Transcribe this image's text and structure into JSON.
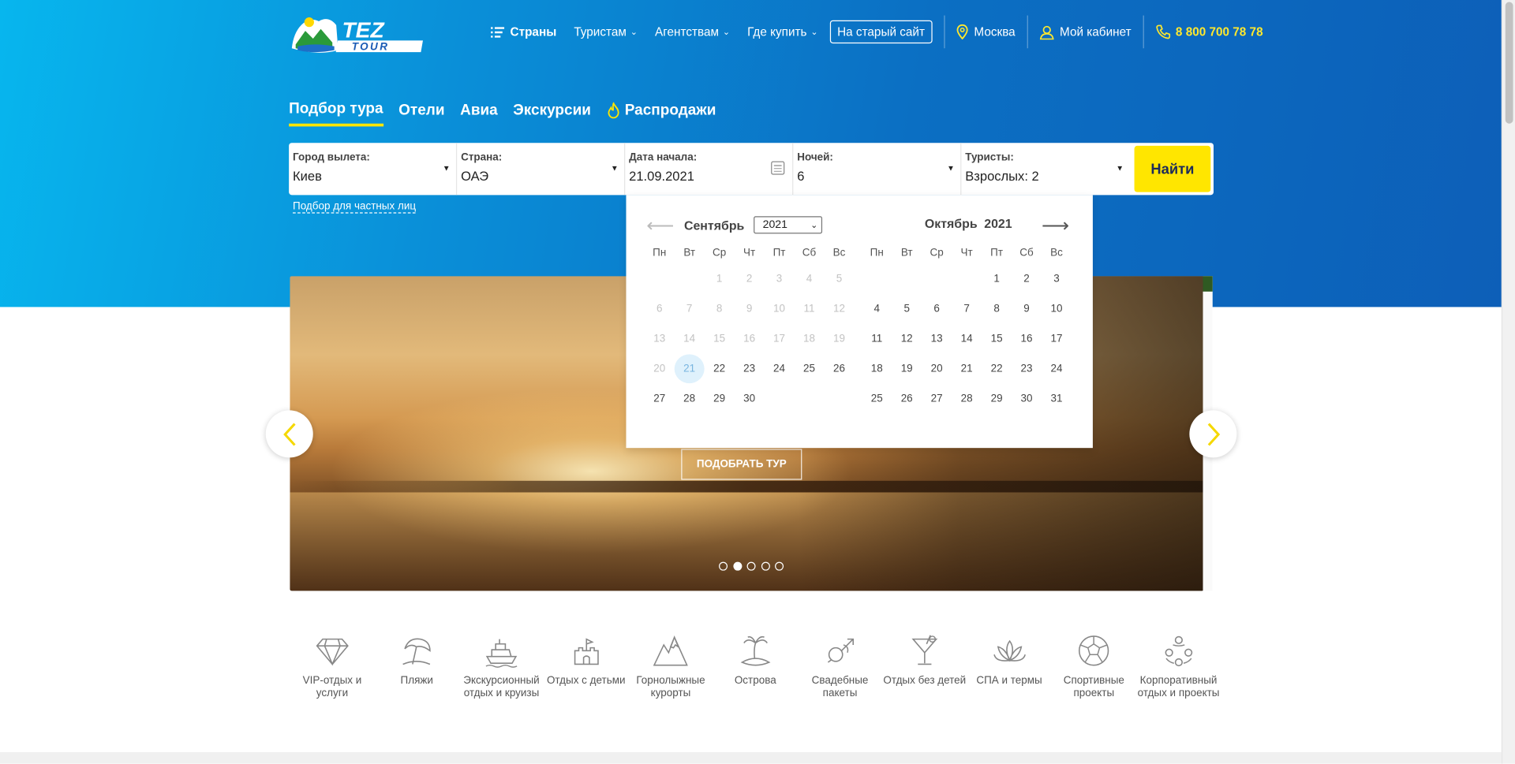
{
  "header": {
    "logo_text": "TEZ TOUR",
    "nav": {
      "countries": "Страны",
      "tourists": "Туристам",
      "agencies": "Агентствам",
      "where_buy": "Где купить",
      "old_site": "На старый сайт",
      "city": "Москва",
      "cabinet": "Мой кабинет",
      "phone": "8 800 700 78 78"
    }
  },
  "tabs": [
    "Подбор тура",
    "Отели",
    "Авиа",
    "Экскурсии",
    "Распродажи"
  ],
  "search": {
    "departure": {
      "label": "Город вылета:",
      "value": "Киев"
    },
    "country": {
      "label": "Страна:",
      "value": "ОАЭ"
    },
    "date": {
      "label": "Дата начала:",
      "value": "21.09.2021"
    },
    "nights": {
      "label": "Ночей:",
      "value": "6"
    },
    "tourists": {
      "label": "Туристы:",
      "value": "Взрослых: 2"
    },
    "find": "Найти",
    "private_link": "Подбор для частных лиц"
  },
  "calendar": {
    "left": {
      "month": "Сентябрь",
      "year": "2021"
    },
    "right": {
      "month": "Октябрь",
      "year": "2021"
    },
    "weekdays": [
      "Пн",
      "Вт",
      "Ср",
      "Чт",
      "Пт",
      "Сб",
      "Вс"
    ],
    "selected_day": "21",
    "september_weeks": [
      [
        "",
        "",
        "1",
        "2",
        "3",
        "4",
        "5"
      ],
      [
        "6",
        "7",
        "8",
        "9",
        "10",
        "11",
        "12"
      ],
      [
        "13",
        "14",
        "15",
        "16",
        "17",
        "18",
        "19"
      ],
      [
        "20",
        "21",
        "22",
        "23",
        "24",
        "25",
        "26"
      ],
      [
        "27",
        "28",
        "29",
        "30",
        "",
        "",
        ""
      ]
    ],
    "october_weeks": [
      [
        "",
        "",
        "",
        "",
        "1",
        "2",
        "3"
      ],
      [
        "4",
        "5",
        "6",
        "7",
        "8",
        "9",
        "10"
      ],
      [
        "11",
        "12",
        "13",
        "14",
        "15",
        "16",
        "17"
      ],
      [
        "18",
        "19",
        "20",
        "21",
        "22",
        "23",
        "24"
      ],
      [
        "25",
        "26",
        "27",
        "28",
        "29",
        "30",
        "31"
      ]
    ]
  },
  "banner": {
    "cta": "ПОДОБРАТЬ ТУР",
    "slides": 5,
    "active_slide": 2
  },
  "categories": [
    {
      "label": "VIP-отдых и услуги",
      "icon": "diamond-icon"
    },
    {
      "label": "Пляжи",
      "icon": "beach-umbrella-icon"
    },
    {
      "label": "Экскурсионный отдых и круизы",
      "icon": "cruise-ship-icon"
    },
    {
      "label": "Отдых с детьми",
      "icon": "sandcastle-icon"
    },
    {
      "label": "Горнолыжные курорты",
      "icon": "mountains-icon"
    },
    {
      "label": "Острова",
      "icon": "palm-island-icon"
    },
    {
      "label": "Свадебные пакеты",
      "icon": "wedding-icon"
    },
    {
      "label": "Отдых без детей",
      "icon": "cocktail-icon"
    },
    {
      "label": "СПА и термы",
      "icon": "lotus-icon"
    },
    {
      "label": "Спортивные проекты",
      "icon": "ball-icon"
    },
    {
      "label": "Корпоративный отдых и проекты",
      "icon": "team-icon"
    }
  ],
  "colors": {
    "accent_yellow": "#ffe600",
    "phone_yellow": "#ffe82e",
    "hero_blue": "#0b6fc3",
    "cyan": "#07b6ee"
  }
}
